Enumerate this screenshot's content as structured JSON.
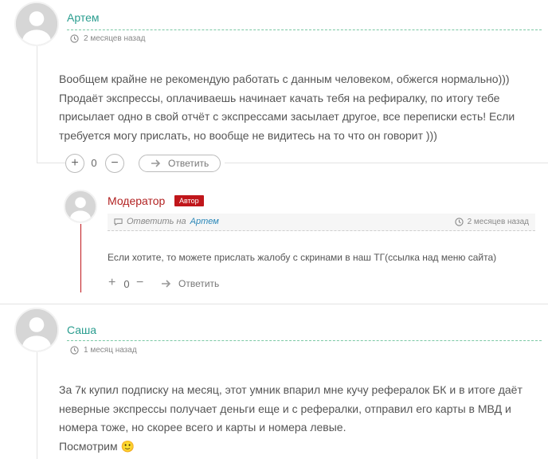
{
  "comments": [
    {
      "author": "Артем",
      "time": "2 месяцев назад",
      "text": [
        "Вообщем крайне не рекомендую работать с данным человеком, обжегся нормально)))",
        "Продаёт экспрессы, оплачиваешь начинает качать тебя на рефиралку, по итогу тебе",
        "присылает одно в свой отчёт с экспрессами засылает другое, все переписки есть! Если",
        "требуется могу прислать, но вообще не видитесь на то что он говорит )))"
      ],
      "plus": "+",
      "minus": "−",
      "score": "0",
      "reply_label": "Ответить"
    },
    {
      "author": "Модератор",
      "badge": "Автор",
      "reply_to_prefix": "Ответить на",
      "reply_to_name": "Артем",
      "time": "2 месяцев назад",
      "text": "Если хотите, то можете прислать жалобу с скринами в наш ТГ(ссылка над меню сайта)",
      "plus": "+",
      "minus": "−",
      "score": "0",
      "reply_label": "Ответить"
    },
    {
      "author": "Саша",
      "time": "1 месяц назад",
      "text": [
        "За 7к купил подписку на месяц, этот умник впарил мне кучу рефералок БК и в итоге даёт",
        "неверные экспрессы получает деньги еще и с рефералки, отправил его карты в МВД и",
        "номера тоже, но скорее всего и карты и номера левые.",
        "Посмотрим"
      ],
      "emoji": "🙂"
    }
  ],
  "colors": {
    "author": "#2a9d8f",
    "moderator": "#b22222",
    "badge": "#c0161b",
    "link": "#2a87b8"
  }
}
